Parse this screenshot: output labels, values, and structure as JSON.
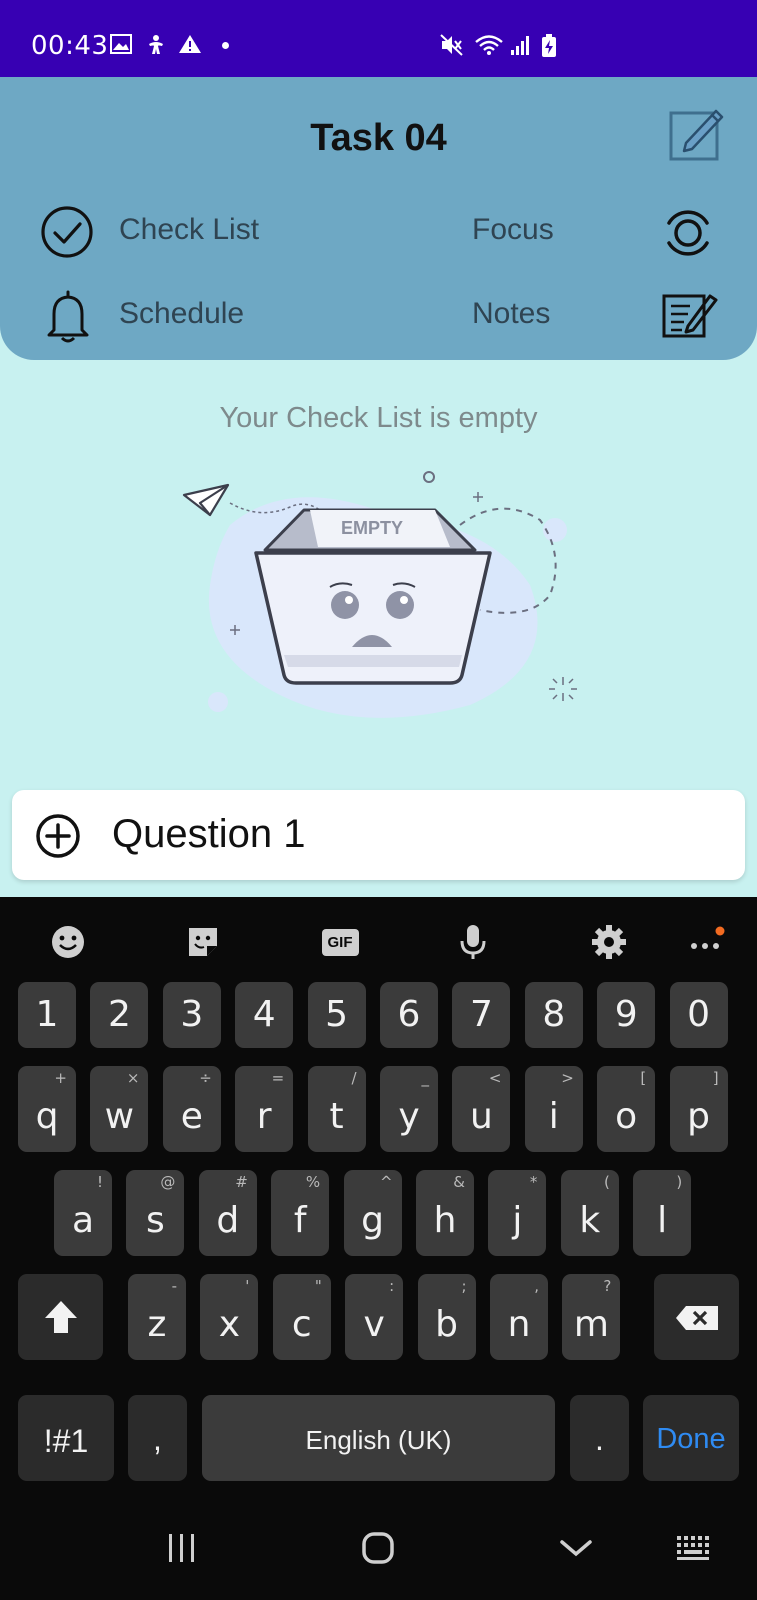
{
  "status_bar": {
    "time": "00:43",
    "icons": [
      "image-icon",
      "accessibility-icon",
      "warning-icon",
      "dot-icon",
      "mute-icon",
      "wifi-icon",
      "signal-icon",
      "battery-charging-icon"
    ]
  },
  "header": {
    "title": "Task 04",
    "menu": {
      "check_list": "Check List",
      "focus": "Focus",
      "schedule": "Schedule",
      "notes": "Notes"
    }
  },
  "empty_state": {
    "message": "Your Check List is empty",
    "box_label": "EMPTY"
  },
  "input": {
    "value": "Question 1"
  },
  "keyboard": {
    "toolbar": [
      "emoji-icon",
      "sticker-icon",
      "gif-icon",
      "mic-icon",
      "settings-icon",
      "more-icon"
    ],
    "gif_label": "GIF",
    "number_row": [
      "1",
      "2",
      "3",
      "4",
      "5",
      "6",
      "7",
      "8",
      "9",
      "0"
    ],
    "row1": [
      {
        "k": "q",
        "s": "+"
      },
      {
        "k": "w",
        "s": "×"
      },
      {
        "k": "e",
        "s": "÷"
      },
      {
        "k": "r",
        "s": "="
      },
      {
        "k": "t",
        "s": "/"
      },
      {
        "k": "y",
        "s": "_"
      },
      {
        "k": "u",
        "s": "<"
      },
      {
        "k": "i",
        "s": ">"
      },
      {
        "k": "o",
        "s": "["
      },
      {
        "k": "p",
        "s": "]"
      }
    ],
    "row2": [
      {
        "k": "a",
        "s": "!"
      },
      {
        "k": "s",
        "s": "@"
      },
      {
        "k": "d",
        "s": "#"
      },
      {
        "k": "f",
        "s": "%"
      },
      {
        "k": "g",
        "s": "^"
      },
      {
        "k": "h",
        "s": "&"
      },
      {
        "k": "j",
        "s": "*"
      },
      {
        "k": "k",
        "s": "("
      },
      {
        "k": "l",
        "s": ")"
      }
    ],
    "row3": [
      {
        "k": "z",
        "s": "-"
      },
      {
        "k": "x",
        "s": "'"
      },
      {
        "k": "c",
        "s": "\""
      },
      {
        "k": "v",
        "s": ":"
      },
      {
        "k": "b",
        "s": ";"
      },
      {
        "k": "n",
        "s": ","
      },
      {
        "k": "m",
        "s": "?"
      }
    ],
    "symbols_key": "!#1",
    "comma_key": ",",
    "space_label": "English (UK)",
    "period_key": ".",
    "done_label": "Done"
  },
  "colors": {
    "status_bar": "#3700b3",
    "header": "#6ea8c4",
    "background": "#c8f1f0",
    "done_blue": "#2f8bf2",
    "notification_dot": "#f26b21"
  }
}
